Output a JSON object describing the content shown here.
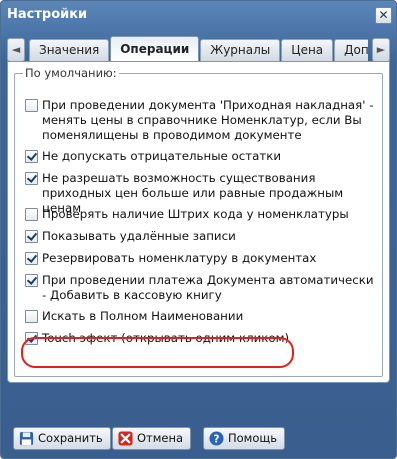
{
  "window": {
    "title": "Настройки",
    "close_glyph": "✕"
  },
  "tabs": [
    {
      "label": "Значения",
      "active": false
    },
    {
      "label": "Операции",
      "active": true
    },
    {
      "label": "Журналы",
      "active": false
    },
    {
      "label": "Цена",
      "active": false
    },
    {
      "label": "Дополнит",
      "active": false
    }
  ],
  "tab_scroll": {
    "left_glyph": "◄",
    "right_glyph": "►"
  },
  "group": {
    "legend": "По умолчанию:",
    "options": [
      {
        "label": "При проведении документа 'Приходная накладная' - менять цены в справочнике Номенклатур, если Вы поменялищены в проводимом документе",
        "checked": false
      },
      {
        "label": "Не допускать отрицательные остатки",
        "checked": true
      },
      {
        "label": "Не разрешать возможность существования приходных цен больше или равные продажным ценам",
        "checked": true
      },
      {
        "label": "Проверять наличие Штрих кода у номенклатуры",
        "checked": false
      },
      {
        "label": "Показывать удалённые записи",
        "checked": true
      },
      {
        "label": "Резервировать номенклатуру в документах",
        "checked": true
      },
      {
        "label": "При проведении платежа Документа автоматически - Добавить в кассовую книгу",
        "checked": true
      },
      {
        "label": "Искать в Полном Наименовании",
        "checked": false
      },
      {
        "label": "Touch эфект (открывать одним кликом)",
        "checked": true
      }
    ]
  },
  "buttons": {
    "save": "Сохранить",
    "cancel": "Отмена",
    "help": "Помощь"
  },
  "colors": {
    "titlebar": "#4d77aa",
    "highlight": "#e0211c"
  }
}
